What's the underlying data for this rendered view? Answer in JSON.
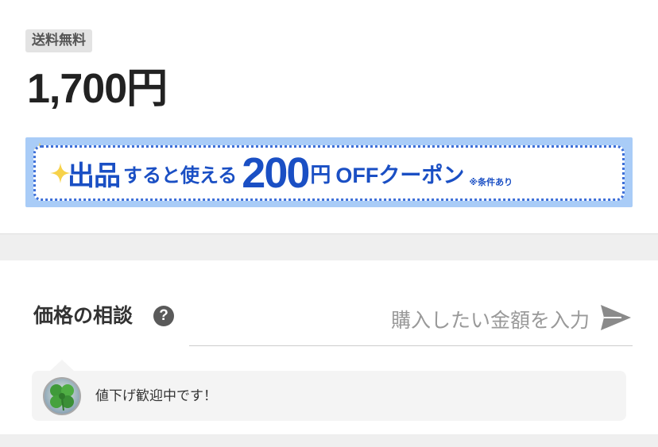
{
  "listing": {
    "shipping_badge": "送料無料",
    "price": "1,700円"
  },
  "coupon_banner": {
    "shuppin": "出品",
    "mid_text": "すると使える",
    "amount": "200",
    "yen": "円",
    "off_text": "OFFクーポン",
    "note": "※条件あり",
    "bg_color": "#a9ccf7",
    "accent_color": "#1a4fc4",
    "sparkle_color": "#f7d24a"
  },
  "price_negotiation": {
    "label": "価格の相談",
    "help_icon": "question-circle-icon",
    "input_placeholder": "購入したい金額を入力",
    "input_value": "",
    "send_icon": "send-arrow-icon"
  },
  "seller_comment": {
    "avatar_icon": "clover-avatar",
    "text": "値下げ歓迎中です！"
  }
}
